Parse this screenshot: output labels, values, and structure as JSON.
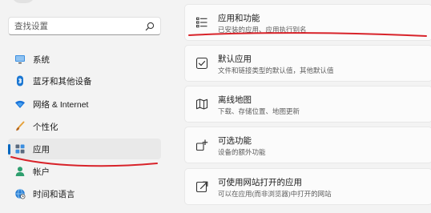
{
  "search": {
    "placeholder": "查找设置"
  },
  "sidebar": {
    "items": [
      {
        "label": "系统",
        "icon": "monitor-icon"
      },
      {
        "label": "蓝牙和其他设备",
        "icon": "bluetooth-icon"
      },
      {
        "label": "网络 & Internet",
        "icon": "wifi-icon"
      },
      {
        "label": "个性化",
        "icon": "brush-icon"
      },
      {
        "label": "应用",
        "icon": "apps-icon",
        "selected": true
      },
      {
        "label": "帐户",
        "icon": "person-icon"
      },
      {
        "label": "时间和语言",
        "icon": "globe-clock-icon"
      }
    ]
  },
  "main": {
    "cards": [
      {
        "title": "应用和功能",
        "desc": "已安装的应用、应用执行别名",
        "icon": "list-icon"
      },
      {
        "title": "默认应用",
        "desc": "文件和链接类型的默认值，其他默认值",
        "icon": "default-apps-icon"
      },
      {
        "title": "离线地图",
        "desc": "下载、存储位置、地图更新",
        "icon": "map-icon"
      },
      {
        "title": "可选功能",
        "desc": "设备的额外功能",
        "icon": "add-feature-icon"
      },
      {
        "title": "可使用网站打开的应用",
        "desc": "可以在应用(而非浏览器)中打开的网站",
        "icon": "open-in-app-icon"
      }
    ]
  },
  "colors": {
    "accent": "#0067c0",
    "annotation": "#d8232a",
    "background": "#f3f3f3"
  }
}
